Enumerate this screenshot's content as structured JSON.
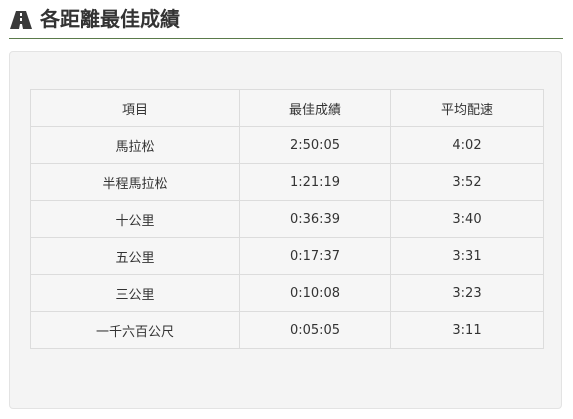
{
  "header": {
    "icon": "road-icon",
    "title": "各距離最佳成績",
    "accent_color": "#5a7a4a"
  },
  "table": {
    "columns": [
      "項目",
      "最佳成績",
      "平均配速"
    ],
    "rows": [
      {
        "event": "馬拉松",
        "best": "2:50:05",
        "pace": "4:02"
      },
      {
        "event": "半程馬拉松",
        "best": "1:21:19",
        "pace": "3:52"
      },
      {
        "event": "十公里",
        "best": "0:36:39",
        "pace": "3:40"
      },
      {
        "event": "五公里",
        "best": "0:17:37",
        "pace": "3:31"
      },
      {
        "event": "三公里",
        "best": "0:10:08",
        "pace": "3:23"
      },
      {
        "event": "一千六百公尺",
        "best": "0:05:05",
        "pace": "3:11"
      }
    ]
  }
}
